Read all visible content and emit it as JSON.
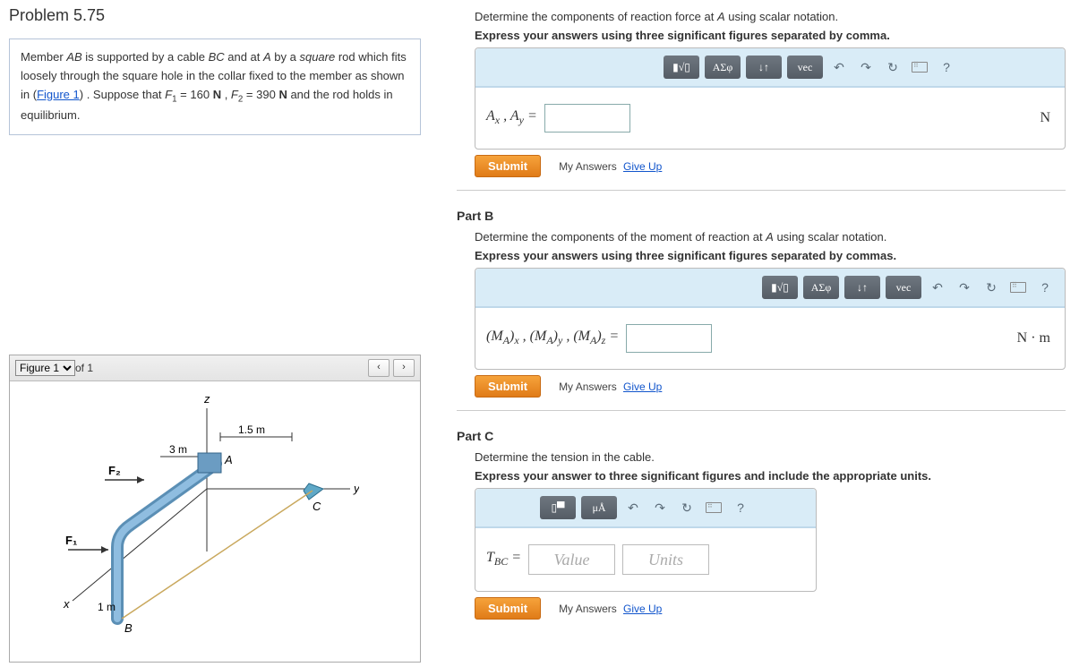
{
  "problem": {
    "title": "Problem 5.75",
    "text_pre": "Member ",
    "ab_i": "AB",
    "text_1": " is supported by a cable ",
    "bc_i": "BC",
    "text_2": " and at ",
    "a_i": "A",
    "text_3": " by a ",
    "square_i": "square",
    "text_4": " rod which fits loosely through the square hole in the collar fixed to the member as shown in (",
    "figlink": "Figure 1",
    "text_5": ") . Suppose that ",
    "f1lbl": "F",
    "f1sub": "1",
    "eq1": " = 160 ",
    "unitN1": "N",
    "comma1": " , ",
    "f2lbl": "F",
    "f2sub": "2",
    "eq2": " = 390 ",
    "unitN2": "N",
    "text_6": " and the rod holds in equilibrium.",
    "figure_sel": "Figure 1",
    "of1": " of 1"
  },
  "partA": {
    "instr1": "Determine the components of reaction force at A using scalar notation.",
    "instr2": "Express your answers using three significant figures separated by comma.",
    "lhs_html": "A_x , A_y =",
    "unit": "N"
  },
  "partB": {
    "title": "Part B",
    "instr1": "Determine the components of the moment of reaction at A using scalar notation.",
    "instr2": "Express your answers using three significant figures separated by commas.",
    "lhs": "(M_A)_x , (M_A)_y , (M_A)_z =",
    "unit": "N · m"
  },
  "partC": {
    "title": "Part C",
    "instr1": "Determine the tension in the cable.",
    "instr2": "Express your answer to three significant figures and include the appropriate units.",
    "lhs": "T_BC =",
    "value_ph": "Value",
    "units_ph": "Units"
  },
  "common": {
    "submit": "Submit",
    "my": "My Answers",
    "giveup": "Give Up",
    "tool_frac": "▮√▯",
    "tool_greek": "ΑΣφ",
    "tool_arrows": "↓↑",
    "tool_vec": "vec",
    "tool_undo": "↶",
    "tool_redo": "↷",
    "tool_reset": "↻",
    "tool_help": "?",
    "tool_units": "μÅ",
    "tool_tpl": "▯▀"
  },
  "figure": {
    "z": "z",
    "y": "y",
    "x": "x",
    "A": "A",
    "B": "B",
    "C": "C",
    "d1": "1.5 m",
    "d2": "3 m",
    "d3": "1 m",
    "F1": "F₁",
    "F2": "F₂"
  }
}
